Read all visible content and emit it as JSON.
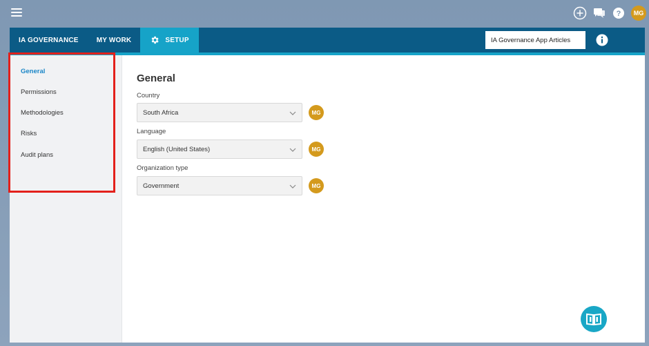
{
  "topbar": {
    "menu_icon": "hamburger-icon",
    "icons": [
      "add-circle-icon",
      "chat-icon",
      "help-icon"
    ],
    "user_initials": "MG"
  },
  "nav": {
    "tabs": [
      {
        "label": "IA GOVERNANCE",
        "active": false
      },
      {
        "label": "MY WORK",
        "active": false
      },
      {
        "label": "SETUP",
        "active": true,
        "icon": "gear-icon"
      }
    ],
    "articles_button": "IA Governance App Articles",
    "info_icon": "info-icon"
  },
  "sidebar": {
    "items": [
      {
        "label": "General",
        "active": true
      },
      {
        "label": "Permissions",
        "active": false
      },
      {
        "label": "Methodologies",
        "active": false
      },
      {
        "label": "Risks",
        "active": false
      },
      {
        "label": "Audit plans",
        "active": false
      }
    ]
  },
  "main": {
    "title": "General",
    "fields": [
      {
        "label": "Country",
        "value": "South Africa",
        "owner": "MG"
      },
      {
        "label": "Language",
        "value": "English (United States)",
        "owner": "MG"
      },
      {
        "label": "Organization type",
        "value": "Government",
        "owner": "MG"
      }
    ]
  },
  "help_fab_icon": "book-help-icon",
  "colors": {
    "navbar": "#0b5b86",
    "accent": "#16a3c8",
    "avatar": "#d49a1d",
    "highlight": "#e3201b",
    "active_link": "#1a86c7"
  }
}
